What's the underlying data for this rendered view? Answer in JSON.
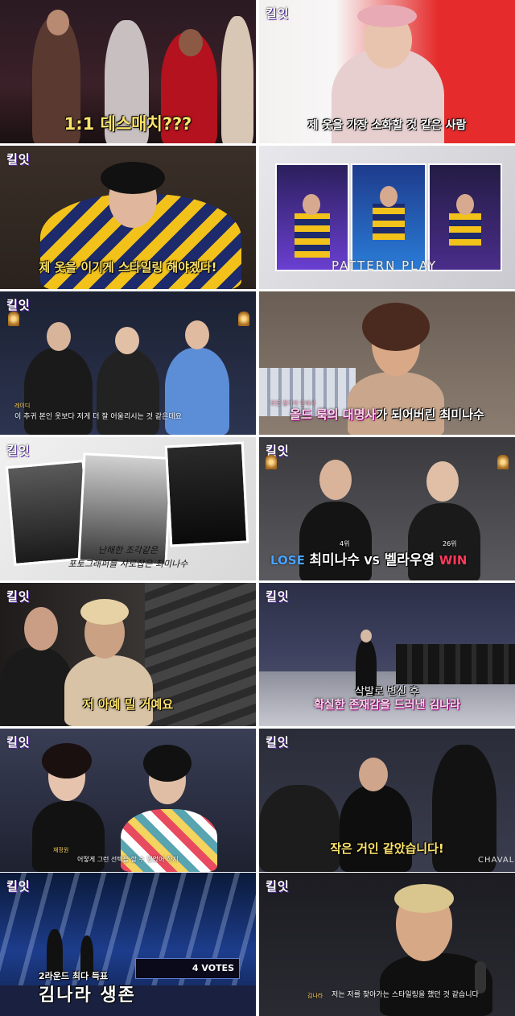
{
  "logo_text": "킬잇",
  "panels": [
    {
      "id": "p1",
      "caption": "1:1 데스매치???"
    },
    {
      "id": "p2",
      "caption": "제 옷을 가장 소화할 것 같은 사람"
    },
    {
      "id": "p3",
      "caption": "제 옷을 이기게 스타일링 해야겠다!"
    },
    {
      "id": "p4",
      "caption": "PATTERN PLAY"
    },
    {
      "id": "p5",
      "lower_name": "레이디",
      "lower_quote": "이 추귀 본인 옷보다 저게 더 잘 어울리시는 것 같은데요"
    },
    {
      "id": "p6",
      "tag": "모든 참가자 앞에서",
      "caption_main": "올드 룩의 대명사",
      "caption_tail": "가 되어버린 최미나수"
    },
    {
      "id": "p7",
      "caption_line1": "난해한 조각같은",
      "caption_line2": "포토그래퍼를 사로잡은 최미나수"
    },
    {
      "id": "p8",
      "left_rank": "4위",
      "right_rank": "26위",
      "lose": "LOSE",
      "left_name": "최미나수",
      "vs": "VS",
      "right_name": "벨라우영",
      "win": "WIN"
    },
    {
      "id": "p9",
      "caption": "저 아예 밀 거예요"
    },
    {
      "id": "p10",
      "caption_line1": "삭발로 변신 후",
      "caption_line2": "확실한 존재감을 드러낸 김나라"
    },
    {
      "id": "p11",
      "lower_name": "채정원",
      "lower_quote": "어떻게 그런 선택을 할 수 있었어 하지"
    },
    {
      "id": "p12",
      "caption": "작은 거인 같았습니다!",
      "sign": "CHAVAL"
    },
    {
      "id": "p13",
      "caption_line1": "2라운드 최다 득표",
      "caption_line2": "김나라 생존",
      "votes": "4 VOTES"
    },
    {
      "id": "p14",
      "lower_name": "김나라",
      "lower_quote": "저는 저를 찾아가는 스타일링을 했던 것 같습니다"
    }
  ]
}
